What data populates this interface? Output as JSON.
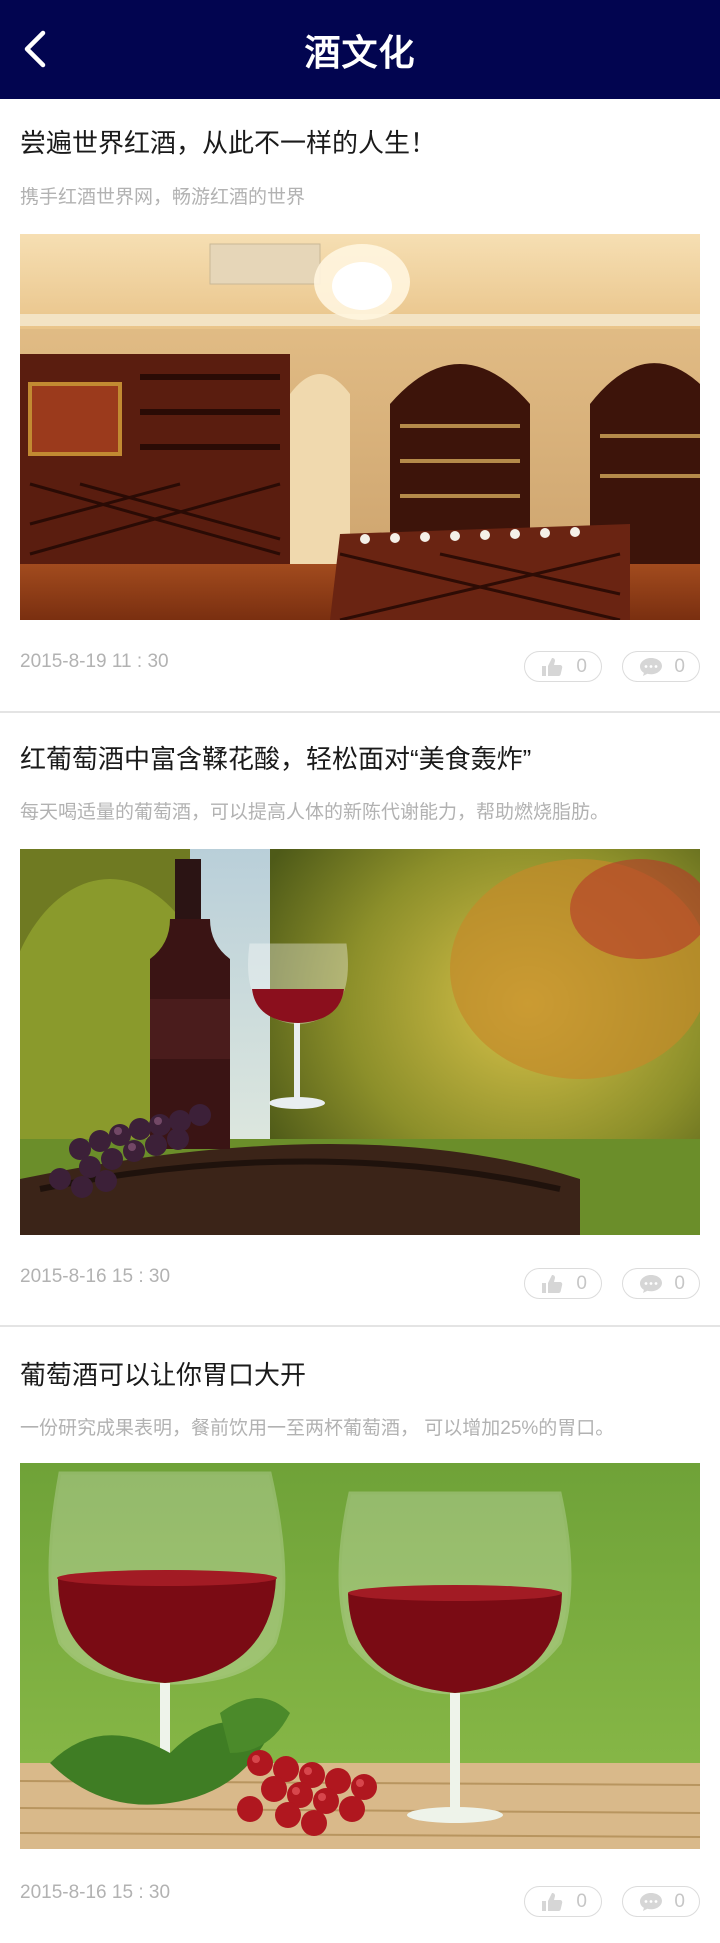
{
  "header": {
    "title": "酒文化",
    "background_color": "#020550",
    "back_icon": "chevron-left-icon"
  },
  "articles": [
    {
      "title": "尝遍世界红酒，从此不一样的人生！",
      "subtitle": "携手红酒世界网，畅游红酒的世界",
      "image": "wine-cellar-interior",
      "date": "2015-8-19 11 : 30",
      "likes": "0",
      "comments": "0"
    },
    {
      "title": "红葡萄酒中富含鞣花酸，轻松面对“美食轰炸”",
      "subtitle": "每天喝适量的葡萄酒，可以提高人体的新陈代谢能力，帮助燃烧脂肪。",
      "image": "vineyard-wine-bottle-glass",
      "date": "2015-8-16 15 : 30",
      "likes": "0",
      "comments": "0"
    },
    {
      "title": "葡萄酒可以让你胃口大开",
      "subtitle": "一份研究成果表明，餐前饮用一至两杯葡萄酒， 可以增加25%的胃口。",
      "image": "two-wine-glasses-grapes",
      "date": "2015-8-16 15 : 30",
      "likes": "0",
      "comments": "0"
    }
  ],
  "icons": {
    "like": "thumbs-up-icon",
    "comment": "speech-bubble-icon"
  },
  "colors": {
    "muted_text": "#b2b2b2",
    "divider": "#e4e4e4"
  }
}
